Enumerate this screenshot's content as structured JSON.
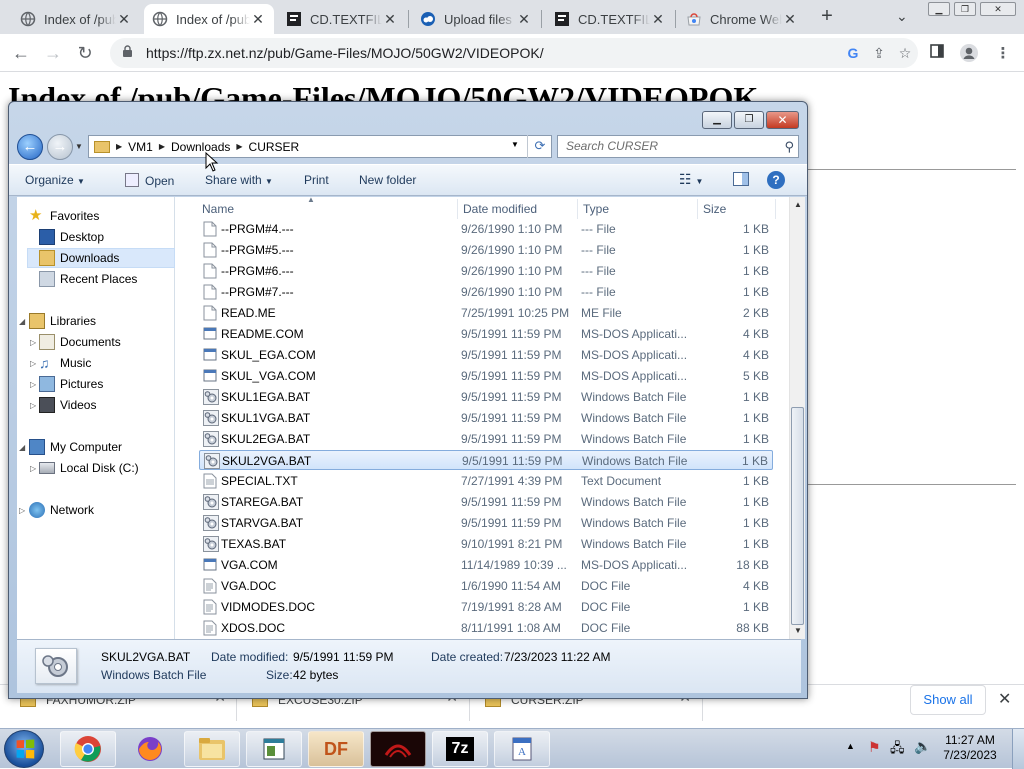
{
  "browser": {
    "tabs": [
      {
        "title": "Index of /pub/Game-Files",
        "icon": "globe-icon"
      },
      {
        "title": "Index of /pub/Game-Files",
        "icon": "globe-icon",
        "active": true
      },
      {
        "title": "CD.TEXTFILE",
        "icon": "document-icon"
      },
      {
        "title": "Upload files",
        "icon": "cloud-icon"
      },
      {
        "title": "CD.TEXTFILE",
        "icon": "document-icon"
      },
      {
        "title": "Chrome Web Store",
        "icon": "webstore-icon"
      }
    ],
    "new_tab": "+",
    "url": "https://ftp.zx.net.nz/pub/Game-Files/MOJO/50GW2/VIDEOPOK/",
    "page_heading": "Index of /pub/Game-Files/MOJO/50GW2/VIDEOPOK"
  },
  "downloads": {
    "items": [
      "FAXHUMOR.ZIP",
      "EXCUSE30.ZIP",
      "CURSER.ZIP"
    ],
    "show_all": "Show all"
  },
  "explorer": {
    "breadcrumb": [
      "VM1",
      "Downloads",
      "CURSER"
    ],
    "search_placeholder": "Search CURSER",
    "commands": {
      "organize": "Organize",
      "open": "Open",
      "share": "Share with",
      "print": "Print",
      "new_folder": "New folder"
    },
    "nav": {
      "favorites": "Favorites",
      "desktop": "Desktop",
      "downloads": "Downloads",
      "recent": "Recent Places",
      "libraries": "Libraries",
      "documents": "Documents",
      "music": "Music",
      "pictures": "Pictures",
      "videos": "Videos",
      "computer": "My Computer",
      "localdisk": "Local Disk (C:)",
      "network": "Network"
    },
    "columns": {
      "name": "Name",
      "date": "Date modified",
      "type": "Type",
      "size": "Size"
    },
    "files": [
      {
        "name": "--PRGM#4.---",
        "date": "9/26/1990 1:10 PM",
        "type": "--- File",
        "size": "1 KB",
        "icon": "blank-file-icon"
      },
      {
        "name": "--PRGM#5.---",
        "date": "9/26/1990 1:10 PM",
        "type": "--- File",
        "size": "1 KB",
        "icon": "blank-file-icon"
      },
      {
        "name": "--PRGM#6.---",
        "date": "9/26/1990 1:10 PM",
        "type": "--- File",
        "size": "1 KB",
        "icon": "blank-file-icon"
      },
      {
        "name": "--PRGM#7.---",
        "date": "9/26/1990 1:10 PM",
        "type": "--- File",
        "size": "1 KB",
        "icon": "blank-file-icon"
      },
      {
        "name": "READ.ME",
        "date": "7/25/1991 10:25 PM",
        "type": "ME File",
        "size": "2 KB",
        "icon": "blank-file-icon"
      },
      {
        "name": "README.COM",
        "date": "9/5/1991 11:59 PM",
        "type": "MS-DOS Applicati...",
        "size": "4 KB",
        "icon": "app-icon"
      },
      {
        "name": "SKUL_EGA.COM",
        "date": "9/5/1991 11:59 PM",
        "type": "MS-DOS Applicati...",
        "size": "4 KB",
        "icon": "app-icon"
      },
      {
        "name": "SKUL_VGA.COM",
        "date": "9/5/1991 11:59 PM",
        "type": "MS-DOS Applicati...",
        "size": "5 KB",
        "icon": "app-icon"
      },
      {
        "name": "SKUL1EGA.BAT",
        "date": "9/5/1991 11:59 PM",
        "type": "Windows Batch File",
        "size": "1 KB",
        "icon": "batch-gear-icon"
      },
      {
        "name": "SKUL1VGA.BAT",
        "date": "9/5/1991 11:59 PM",
        "type": "Windows Batch File",
        "size": "1 KB",
        "icon": "batch-gear-icon"
      },
      {
        "name": "SKUL2EGA.BAT",
        "date": "9/5/1991 11:59 PM",
        "type": "Windows Batch File",
        "size": "1 KB",
        "icon": "batch-gear-icon"
      },
      {
        "name": "SKUL2VGA.BAT",
        "date": "9/5/1991 11:59 PM",
        "type": "Windows Batch File",
        "size": "1 KB",
        "icon": "batch-gear-icon",
        "selected": true
      },
      {
        "name": "SPECIAL.TXT",
        "date": "7/27/1991 4:39 PM",
        "type": "Text Document",
        "size": "1 KB",
        "icon": "text-file-icon"
      },
      {
        "name": "STAREGA.BAT",
        "date": "9/5/1991 11:59 PM",
        "type": "Windows Batch File",
        "size": "1 KB",
        "icon": "batch-gear-icon"
      },
      {
        "name": "STARVGA.BAT",
        "date": "9/5/1991 11:59 PM",
        "type": "Windows Batch File",
        "size": "1 KB",
        "icon": "batch-gear-icon"
      },
      {
        "name": "TEXAS.BAT",
        "date": "9/10/1991 8:21 PM",
        "type": "Windows Batch File",
        "size": "1 KB",
        "icon": "batch-gear-icon"
      },
      {
        "name": "VGA.COM",
        "date": "11/14/1989 10:39 ...",
        "type": "MS-DOS Applicati...",
        "size": "18 KB",
        "icon": "app-icon"
      },
      {
        "name": "VGA.DOC",
        "date": "1/6/1990 11:54 AM",
        "type": "DOC File",
        "size": "4 KB",
        "icon": "doc-file-icon"
      },
      {
        "name": "VIDMODES.DOC",
        "date": "7/19/1991 8:28 AM",
        "type": "DOC File",
        "size": "1 KB",
        "icon": "doc-file-icon"
      },
      {
        "name": "XDOS.DOC",
        "date": "8/11/1991 1:08 AM",
        "type": "DOC File",
        "size": "88 KB",
        "icon": "doc-file-icon"
      }
    ],
    "details": {
      "name": "SKUL2VGA.BAT",
      "type": "Windows Batch File",
      "modified_label": "Date modified:",
      "modified": "9/5/1991 11:59 PM",
      "created_label": "Date created:",
      "created": "7/23/2023 11:22 AM",
      "size_label": "Size:",
      "size": "42 bytes"
    }
  },
  "taskbar": {
    "apps": [
      "chrome-icon",
      "firefox-icon",
      "file-explorer-icon",
      "notepad-icon",
      "df-app-icon",
      "red-app-icon",
      "7zip-icon",
      "wordpad-icon"
    ],
    "df_label": "DF",
    "sevenzip_label": "7z",
    "time": "11:27 AM",
    "date": "7/23/2023"
  }
}
